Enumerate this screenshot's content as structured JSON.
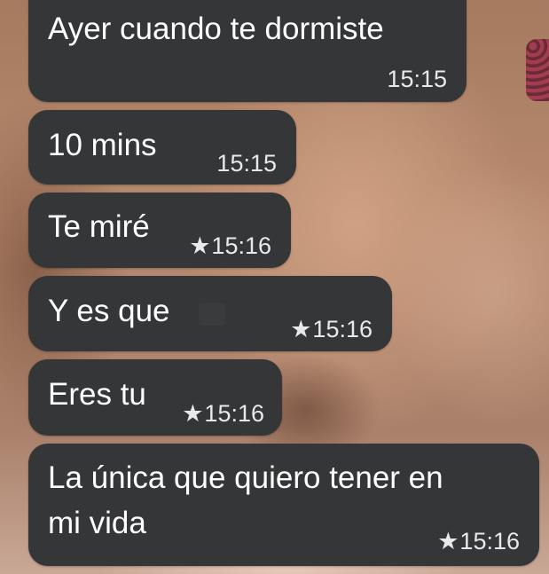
{
  "chat": {
    "messages": [
      {
        "text": "Ayer cuando te dormiste",
        "time": "15:15",
        "starred": false
      },
      {
        "text": "10 mins",
        "time": "15:15",
        "starred": false
      },
      {
        "text": "Te miré",
        "time": "15:16",
        "starred": true
      },
      {
        "text": "Y es que",
        "time": "15:16",
        "starred": true
      },
      {
        "text": "Eres tu",
        "time": "15:16",
        "starred": true
      },
      {
        "text_line1": "La única que quiero tener en",
        "text_line2": "mi vida",
        "time": "15:16",
        "starred": true
      }
    ]
  },
  "icons": {
    "star": "star-icon"
  },
  "colors": {
    "bubble": "#353638",
    "text": "#ffffff",
    "meta": "#e9e9e9"
  }
}
